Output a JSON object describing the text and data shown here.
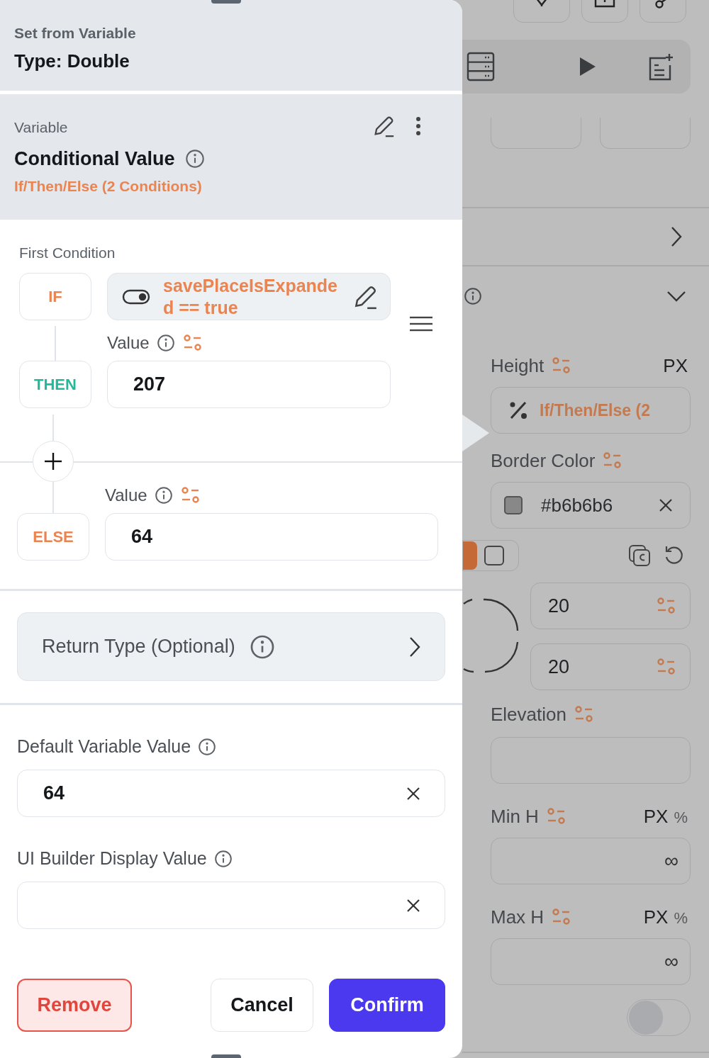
{
  "header": {
    "subtitle": "Set from Variable",
    "title": "Type: Double"
  },
  "variable": {
    "label": "Variable",
    "name": "Conditional Value",
    "summary": "If/Then/Else (2 Conditions)"
  },
  "conditions": {
    "heading": "First Condition",
    "branches": [
      {
        "kind": "if",
        "tag": "IF",
        "expression": "savePlaceIsExpanded == true"
      },
      {
        "kind": "then",
        "tag": "THEN",
        "label": "Value",
        "value": "207"
      },
      {
        "kind": "else",
        "tag": "ELSE",
        "label": "Value",
        "value": "64"
      }
    ]
  },
  "return_type": {
    "label": "Return Type (Optional)"
  },
  "default_value": {
    "label": "Default Variable Value",
    "value": "64"
  },
  "display_value": {
    "label": "UI Builder Display Value"
  },
  "buttons": [
    {
      "kind": "danger",
      "label": "Remove"
    },
    {
      "kind": "secondary",
      "label": "Cancel"
    },
    {
      "kind": "primary",
      "label": "Confirm"
    }
  ],
  "background_panel": {
    "height": {
      "label": "Height",
      "units": [
        {
          "label": "PX",
          "selected": true
        }
      ],
      "value": "If/Then/Else (2"
    },
    "border_color": {
      "label": "Border Color",
      "value": "#b6b6b6"
    },
    "radius": [
      "20",
      "20"
    ],
    "elevation": {
      "label": "Elevation"
    },
    "min_h": {
      "label": "Min H",
      "units": [
        {
          "label": "PX",
          "selected": true
        },
        {
          "label": "%",
          "selected": false
        }
      ],
      "value": "∞"
    },
    "max_h": {
      "label": "Max H",
      "units": [
        {
          "label": "PX",
          "selected": true
        },
        {
          "label": "%",
          "selected": false
        }
      ],
      "value": "∞"
    },
    "toggle": {
      "on": false
    }
  }
}
